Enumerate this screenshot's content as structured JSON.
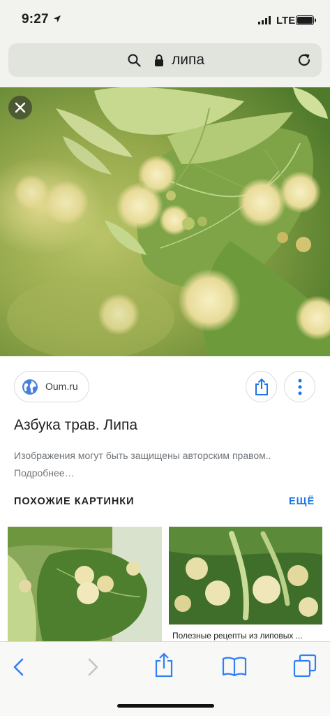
{
  "status_bar": {
    "time": "9:27",
    "network": "LTE"
  },
  "url_bar": {
    "text": "липа"
  },
  "result": {
    "source": "Oum.ru",
    "title": "Азбука трав. Липа",
    "notice": "Изображения могут быть защищены авторским правом..",
    "notice_link": "Подробнее…"
  },
  "similar": {
    "heading": "ПОХОЖИЕ КАРТИНКИ",
    "more_label": "ЕЩЁ",
    "items": [
      {
        "caption": ""
      },
      {
        "caption": "Полезные рецепты из липовых ..."
      }
    ]
  },
  "colors": {
    "accent": "#1a73e8",
    "leaf": "#6e9a3a",
    "blossom": "#f1e7b0"
  }
}
